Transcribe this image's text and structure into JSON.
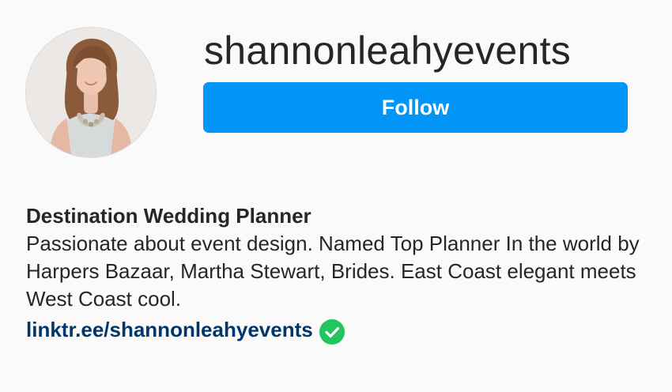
{
  "profile": {
    "username": "shannonleahyevents",
    "avatar_icon": "profile-photo",
    "follow_label": "Follow"
  },
  "bio": {
    "title": "Destination Wedding Planner",
    "text": "Passionate about event design. Named Top Planner In the world by Harpers Bazaar, Martha Stewart, Brides. East Coast elegant meets West Coast cool.",
    "link": "linktr.ee/shannonleahyevents",
    "verified_icon": "verified-check-icon"
  },
  "colors": {
    "follow_button": "#0095f6",
    "link": "#00376b",
    "verified": "#22c55e",
    "background": "#fafafa"
  }
}
